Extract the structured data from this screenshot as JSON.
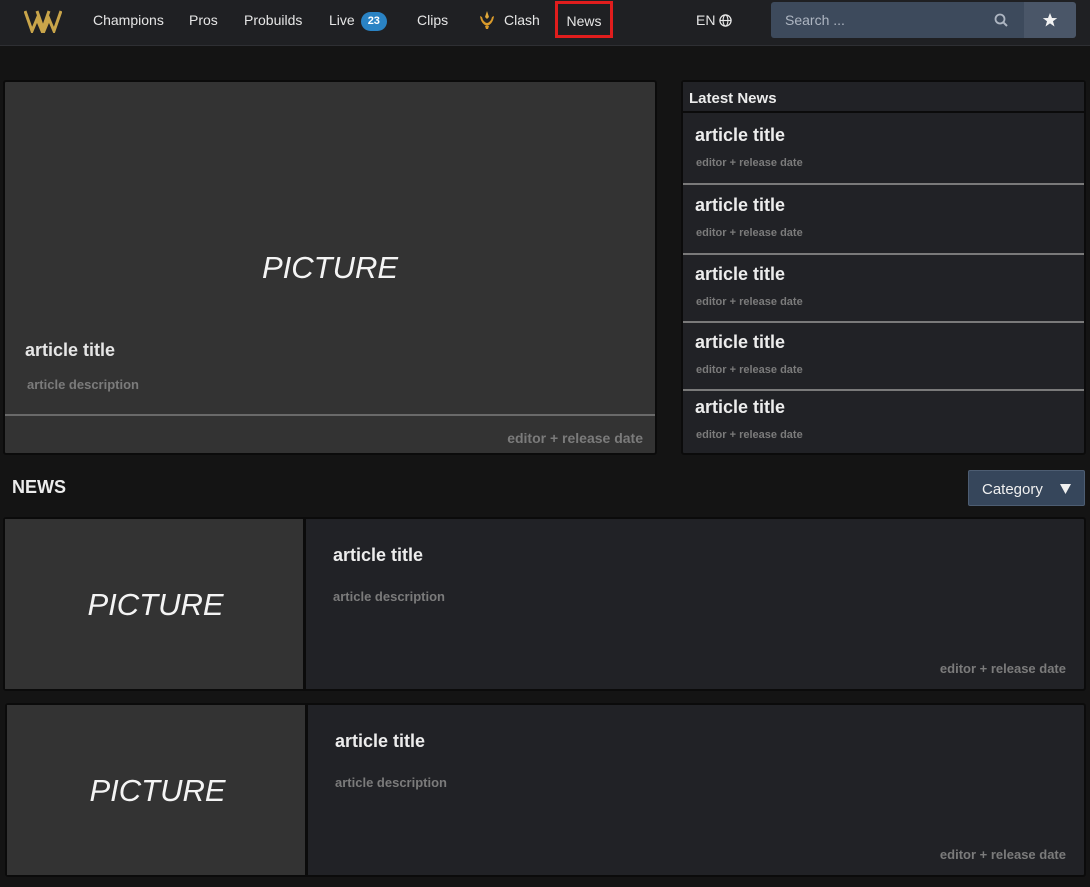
{
  "nav": {
    "items": [
      {
        "label": "Champions"
      },
      {
        "label": "Pros"
      },
      {
        "label": "Probuilds"
      },
      {
        "label": "Live",
        "badge": "23"
      },
      {
        "label": "Clips"
      },
      {
        "label": "Clash"
      },
      {
        "label": "News",
        "active": true
      }
    ],
    "language": "EN",
    "search_placeholder": "Search ...",
    "icons": [
      "logo",
      "clash-icon",
      "globe-icon",
      "search-icon",
      "star-icon"
    ],
    "colors": {
      "accent_badge": "#2a83c4",
      "active_outline": "#e01d1d",
      "search_bg": "#3d4a5c"
    }
  },
  "featured": {
    "picture_label": "PICTURE",
    "title": "article title",
    "description": "article description",
    "meta": "editor + release date"
  },
  "latest": {
    "heading": "Latest News",
    "items": [
      {
        "title": "article title",
        "meta": "editor + release date"
      },
      {
        "title": "article title",
        "meta": "editor + release date"
      },
      {
        "title": "article title",
        "meta": "editor + release date"
      },
      {
        "title": "article title",
        "meta": "editor + release date"
      },
      {
        "title": "article title",
        "meta": "editor + release date"
      }
    ]
  },
  "news": {
    "heading": "NEWS",
    "category_label": "Category",
    "cards": [
      {
        "picture_label": "PICTURE",
        "title": "article title",
        "description": "article description",
        "meta": "editor + release date"
      },
      {
        "picture_label": "PICTURE",
        "title": "article title",
        "description": "article description",
        "meta": "editor + release date"
      }
    ]
  }
}
